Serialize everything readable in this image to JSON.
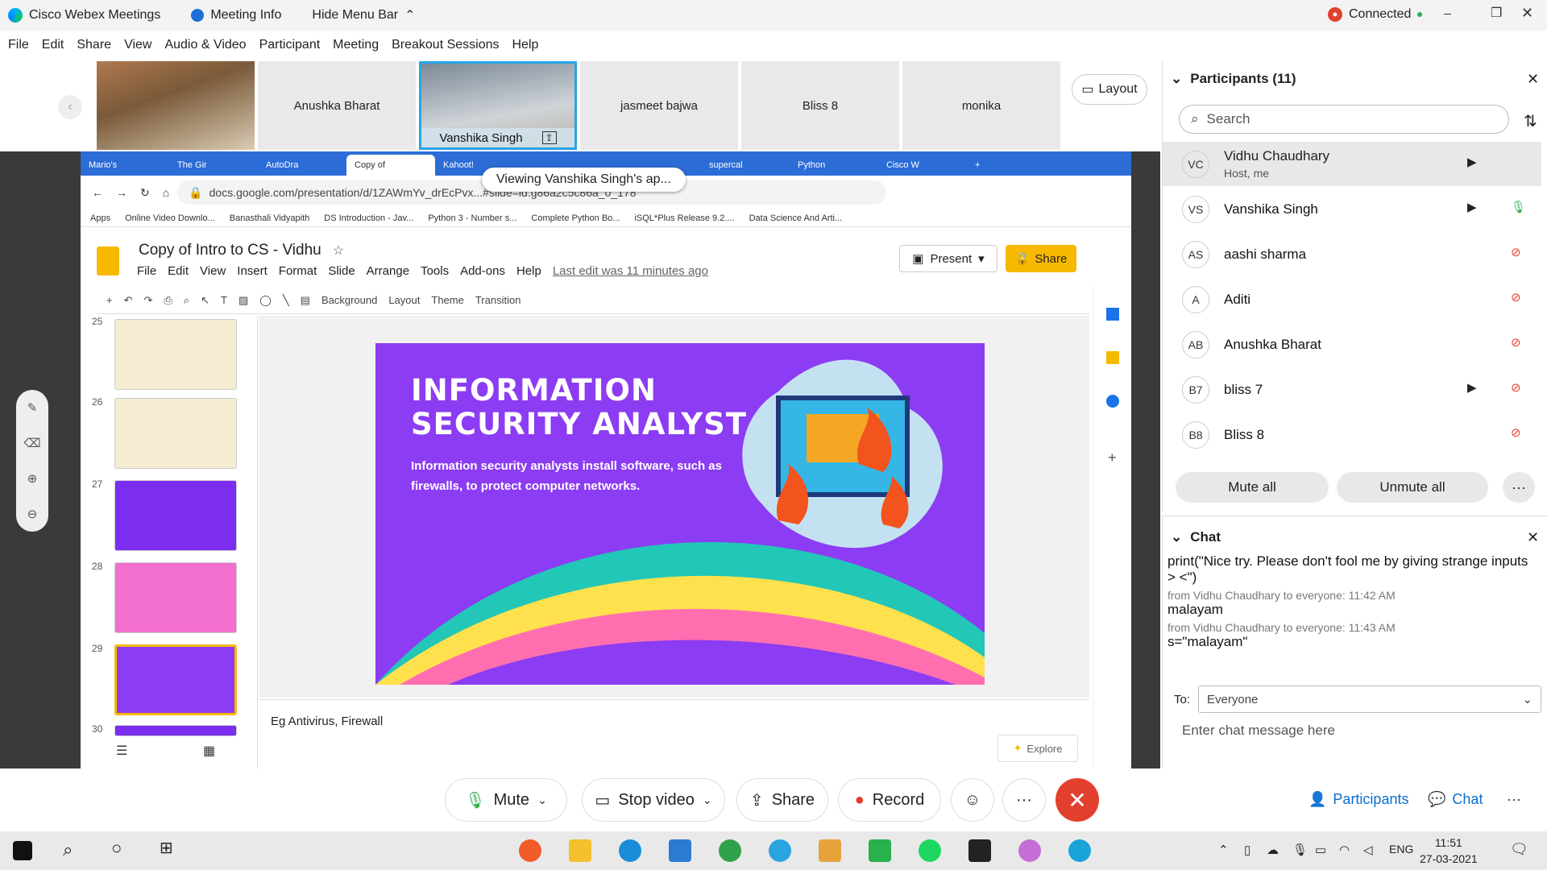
{
  "titlebar": {
    "app": "Cisco Webex Meetings",
    "meeting_info": "Meeting Info",
    "hide_menu": "Hide Menu Bar",
    "status": "Connected"
  },
  "menu": [
    "File",
    "Edit",
    "Share",
    "View",
    "Audio & Video",
    "Participant",
    "Meeting",
    "Breakout Sessions",
    "Help"
  ],
  "videos": {
    "tiles": [
      "Anushka Bharat",
      "jasmeet bajwa",
      "Bliss 8",
      "monika"
    ],
    "active_speaker": "Vanshika Singh",
    "layout_label": "Layout"
  },
  "share": {
    "tooltip": "Viewing Vanshika Singh's ap...",
    "browser_tabs": [
      "Mario's",
      "The Gir",
      "AutoDra",
      "Copy of",
      "Kahoot!",
      "",
      "",
      "supercal",
      "Python",
      "Cisco W"
    ],
    "url": "docs.google.com/presentation/d/1ZAWmYv_drEcPvx...#slide=id.g86a2c5c86a_0_178",
    "bookmarks": [
      "Apps",
      "Online Video Downlo...",
      "Banasthali Vidyapith",
      "DS Introduction - Jav...",
      "Python 3 - Number s...",
      "Complete Python Bo...",
      "iSQL*Plus Release 9.2....",
      "Data Science And Arti..."
    ],
    "doc_title": "Copy of Intro to CS - Vidhu",
    "doc_menu": [
      "File",
      "Edit",
      "View",
      "Insert",
      "Format",
      "Slide",
      "Arrange",
      "Tools",
      "Add-ons",
      "Help"
    ],
    "last_edit": "Last edit was 11 minutes ago",
    "present": "Present",
    "share_btn": "Share",
    "toolbar": [
      "Background",
      "Layout",
      "Theme",
      "Transition"
    ],
    "slide_numbers": [
      "25",
      "26",
      "27",
      "28",
      "29",
      "30"
    ],
    "slide_title_line1": "INFORMATION",
    "slide_title_line2": "SECURITY ANALYST",
    "slide_body": "Information security analysts install software, such as firewalls, to protect computer networks.",
    "notes": "Eg Antivirus, Firewall",
    "explore": "Explore"
  },
  "participants": {
    "title": "Participants (11)",
    "search_placeholder": "Search",
    "list": [
      {
        "initials": "VC",
        "name": "Vidhu Chaudhary",
        "sub": "Host, me"
      },
      {
        "initials": "VS",
        "name": "Vanshika Singh"
      },
      {
        "initials": "AS",
        "name": "aashi sharma"
      },
      {
        "initials": "A",
        "name": "Aditi"
      },
      {
        "initials": "AB",
        "name": "Anushka Bharat"
      },
      {
        "initials": "B7",
        "name": "bliss 7"
      },
      {
        "initials": "B8",
        "name": "Bliss 8"
      }
    ],
    "mute_all": "Mute all",
    "unmute_all": "Unmute all"
  },
  "chat": {
    "title": "Chat",
    "messages": [
      {
        "text": "print(\"Nice try. Please don't fool me by giving strange inputs > <\")"
      },
      {
        "meta": "from Vidhu Chaudhary to everyone:   11:42 AM",
        "text": "malayam"
      },
      {
        "meta": "from Vidhu Chaudhary to everyone:   11:43 AM",
        "text": "s=\"malayam\""
      }
    ],
    "to_label": "To:",
    "to_value": "Everyone",
    "input_placeholder": "Enter chat message here"
  },
  "controls": {
    "mute": "Mute",
    "stop_video": "Stop video",
    "share": "Share",
    "record": "Record",
    "participants": "Participants",
    "chat": "Chat"
  },
  "taskbar": {
    "lang": "ENG",
    "time": "11:51",
    "date": "27-03-2021"
  }
}
